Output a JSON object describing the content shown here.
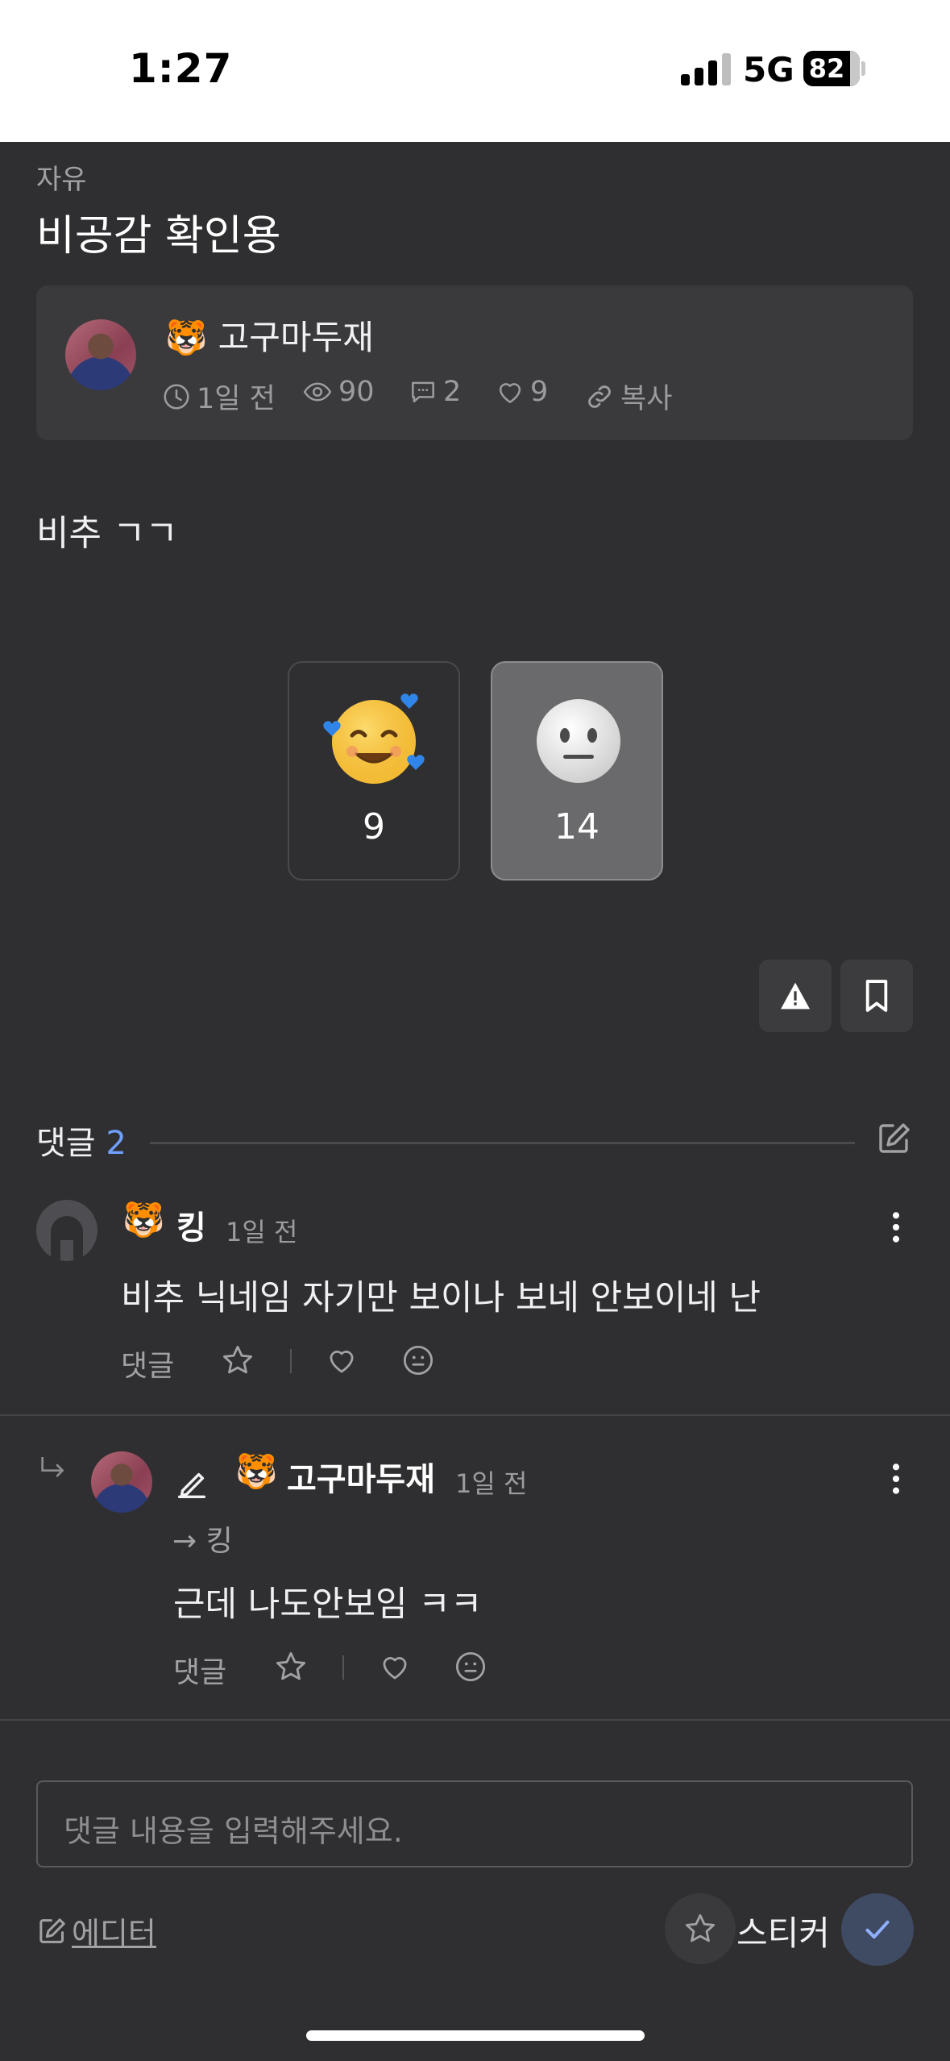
{
  "status_bar": {
    "time": "1:27",
    "network": "5G",
    "battery": "82"
  },
  "post": {
    "category": "자유",
    "title": "비공감 확인용",
    "author": {
      "name": "고구마두재",
      "badge_icon": "tiger-emoji"
    },
    "meta": {
      "time": "1일 전",
      "views": "90",
      "comments": "2",
      "likes": "9",
      "copy_label": "복사"
    },
    "body": "비추 ㄱㄱ"
  },
  "reactions": [
    {
      "name": "smiling-hearts",
      "count": "9",
      "selected": false
    },
    {
      "name": "neutral-face",
      "count": "14",
      "selected": true
    }
  ],
  "comments_section": {
    "label": "댓글",
    "count": "2",
    "items": [
      {
        "author": "킹",
        "time": "1일 전",
        "text": "비추 닉네임 자기만 보이나 보네 안보이네 난",
        "reply_label": "댓글"
      },
      {
        "author": "고구마두재",
        "time": "1일 전",
        "reply_to": "→ 킹",
        "text": "근데 나도안보임 ㅋㅋ",
        "reply_label": "댓글"
      }
    ]
  },
  "composer": {
    "placeholder": "댓글 내용을 입력해주세요.",
    "editor_label": "에디터",
    "sticker_label": "스티커"
  },
  "colors": {
    "background": "#2f2f31",
    "card": "#3a3a3c",
    "accent": "#6f9fff",
    "submit": "#3f4a63"
  }
}
